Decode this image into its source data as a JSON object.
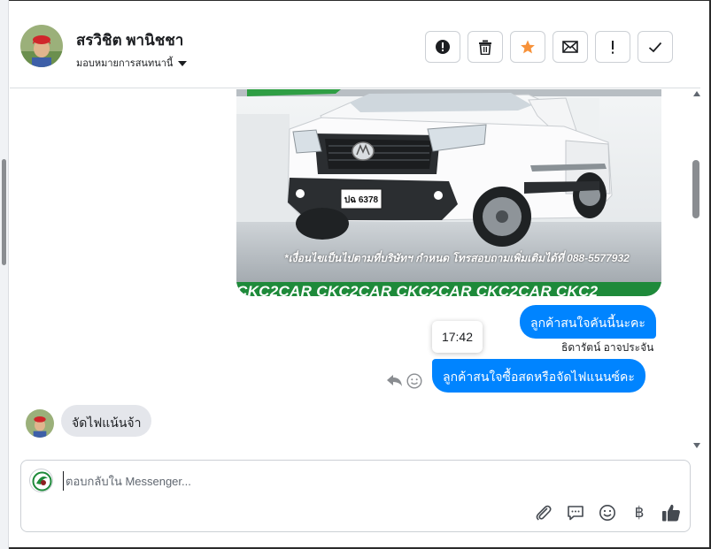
{
  "header": {
    "customer_name": "สรวิชิต พานิชชา",
    "assign_label": "มอบหมายการสนทนานี้",
    "actions": [
      {
        "name": "block-button",
        "icon": "alert-circle-icon"
      },
      {
        "name": "delete-button",
        "icon": "trash-icon"
      },
      {
        "name": "star-button",
        "icon": "star-icon"
      },
      {
        "name": "mark-unread-button",
        "icon": "envelope-icon"
      },
      {
        "name": "spam-button",
        "icon": "exclamation-icon"
      },
      {
        "name": "done-button",
        "icon": "checkmark-icon"
      }
    ]
  },
  "conversation": {
    "car_image": {
      "note_text": "*เงื่อนไขเป็นไปตามที่บริษัทฯ กำหนด โทรสอบถามเพิ่มเติมได้ที่ 088-5577932",
      "banner_text": "CKC2CAR CKC2CAR CKC2CAR CKC2CAR CKC2",
      "plate_text": "ปฉ 6378"
    },
    "outgoing_1": "ลูกค้าสนใจคันนี้นะคะ",
    "sender_name": "ธิดารัตน์ อาจประจัน",
    "timestamp_tooltip": "17:42",
    "outgoing_2": "ลูกค้าสนใจซื้อสดหรือจัดไฟแนนซ์คะ",
    "incoming_1": "จัดไฟแน้นจ้า"
  },
  "composer": {
    "placeholder": "ตอบกลับใน Messenger...",
    "tools": [
      "paperclip-icon",
      "chat-bubble-icon",
      "smiley-icon",
      "baht-icon",
      "thumbs-up-icon"
    ],
    "baht_symbol": "฿"
  },
  "colors": {
    "accent": "#0084ff",
    "star": "#f7923a",
    "incoming_bubble": "#e4e6eb",
    "banner_green": "#1e8a3a"
  }
}
